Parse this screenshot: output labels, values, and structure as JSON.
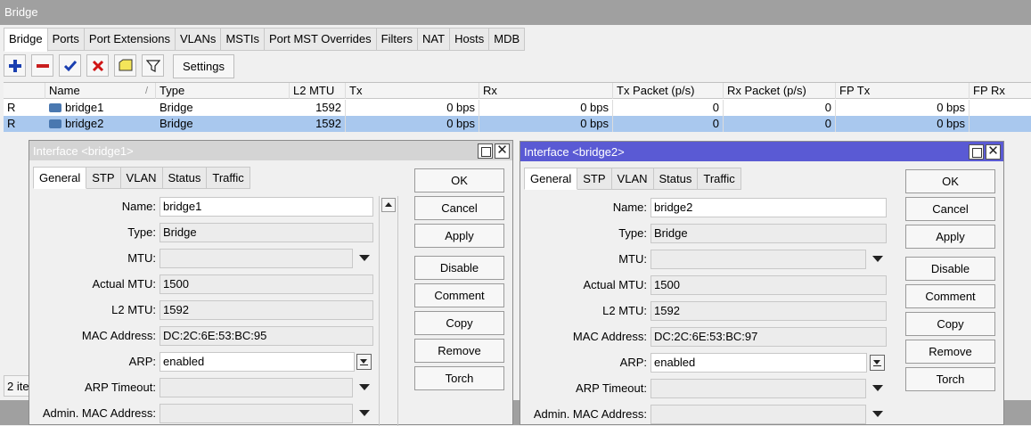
{
  "main": {
    "title": "Bridge",
    "tabs": [
      "Bridge",
      "Ports",
      "Port Extensions",
      "VLANs",
      "MSTIs",
      "Port MST Overrides",
      "Filters",
      "NAT",
      "Hosts",
      "MDB"
    ],
    "toolbar": {
      "settings_label": "Settings"
    },
    "table": {
      "columns": [
        "",
        "Name",
        "Type",
        "L2 MTU",
        "Tx",
        "Rx",
        "Tx Packet (p/s)",
        "Rx Packet (p/s)",
        "FP Tx",
        "FP Rx"
      ],
      "sort_indicator": "/",
      "rows": [
        {
          "flag": "R",
          "name": "bridge1",
          "type": "Bridge",
          "l2mtu": "1592",
          "tx": "0 bps",
          "rx": "0 bps",
          "txp": "0",
          "rxp": "0",
          "fptx": "0 bps",
          "fprx": "",
          "selected": false
        },
        {
          "flag": "R",
          "name": "bridge2",
          "type": "Bridge",
          "l2mtu": "1592",
          "tx": "0 bps",
          "rx": "0 bps",
          "txp": "0",
          "rxp": "0",
          "fptx": "0 bps",
          "fprx": "",
          "selected": true
        }
      ]
    },
    "status": "2 ite"
  },
  "dialogs": [
    {
      "title": "Interface <bridge1>",
      "tabs": [
        "General",
        "STP",
        "VLAN",
        "Status",
        "Traffic"
      ],
      "labels": {
        "name": "Name:",
        "type": "Type:",
        "mtu": "MTU:",
        "actual_mtu": "Actual MTU:",
        "l2mtu": "L2 MTU:",
        "mac": "MAC Address:",
        "arp": "ARP:",
        "arp_timeout": "ARP Timeout:",
        "admin_mac": "Admin. MAC Address:"
      },
      "values": {
        "name": "bridge1",
        "type": "Bridge",
        "mtu": "",
        "actual_mtu": "1500",
        "l2mtu": "1592",
        "mac": "DC:2C:6E:53:BC:95",
        "arp": "enabled",
        "arp_timeout": "",
        "admin_mac": ""
      },
      "buttons": [
        "OK",
        "Cancel",
        "Apply",
        "Disable",
        "Comment",
        "Copy",
        "Remove",
        "Torch"
      ]
    },
    {
      "title": "Interface <bridge2>",
      "tabs": [
        "General",
        "STP",
        "VLAN",
        "Status",
        "Traffic"
      ],
      "labels": {
        "name": "Name:",
        "type": "Type:",
        "mtu": "MTU:",
        "actual_mtu": "Actual MTU:",
        "l2mtu": "L2 MTU:",
        "mac": "MAC Address:",
        "arp": "ARP:",
        "arp_timeout": "ARP Timeout:",
        "admin_mac": "Admin. MAC Address:"
      },
      "values": {
        "name": "bridge2",
        "type": "Bridge",
        "mtu": "",
        "actual_mtu": "1500",
        "l2mtu": "1592",
        "mac": "DC:2C:6E:53:BC:97",
        "arp": "enabled",
        "arp_timeout": "",
        "admin_mac": ""
      },
      "buttons": [
        "OK",
        "Cancel",
        "Apply",
        "Disable",
        "Comment",
        "Copy",
        "Remove",
        "Torch"
      ]
    }
  ]
}
